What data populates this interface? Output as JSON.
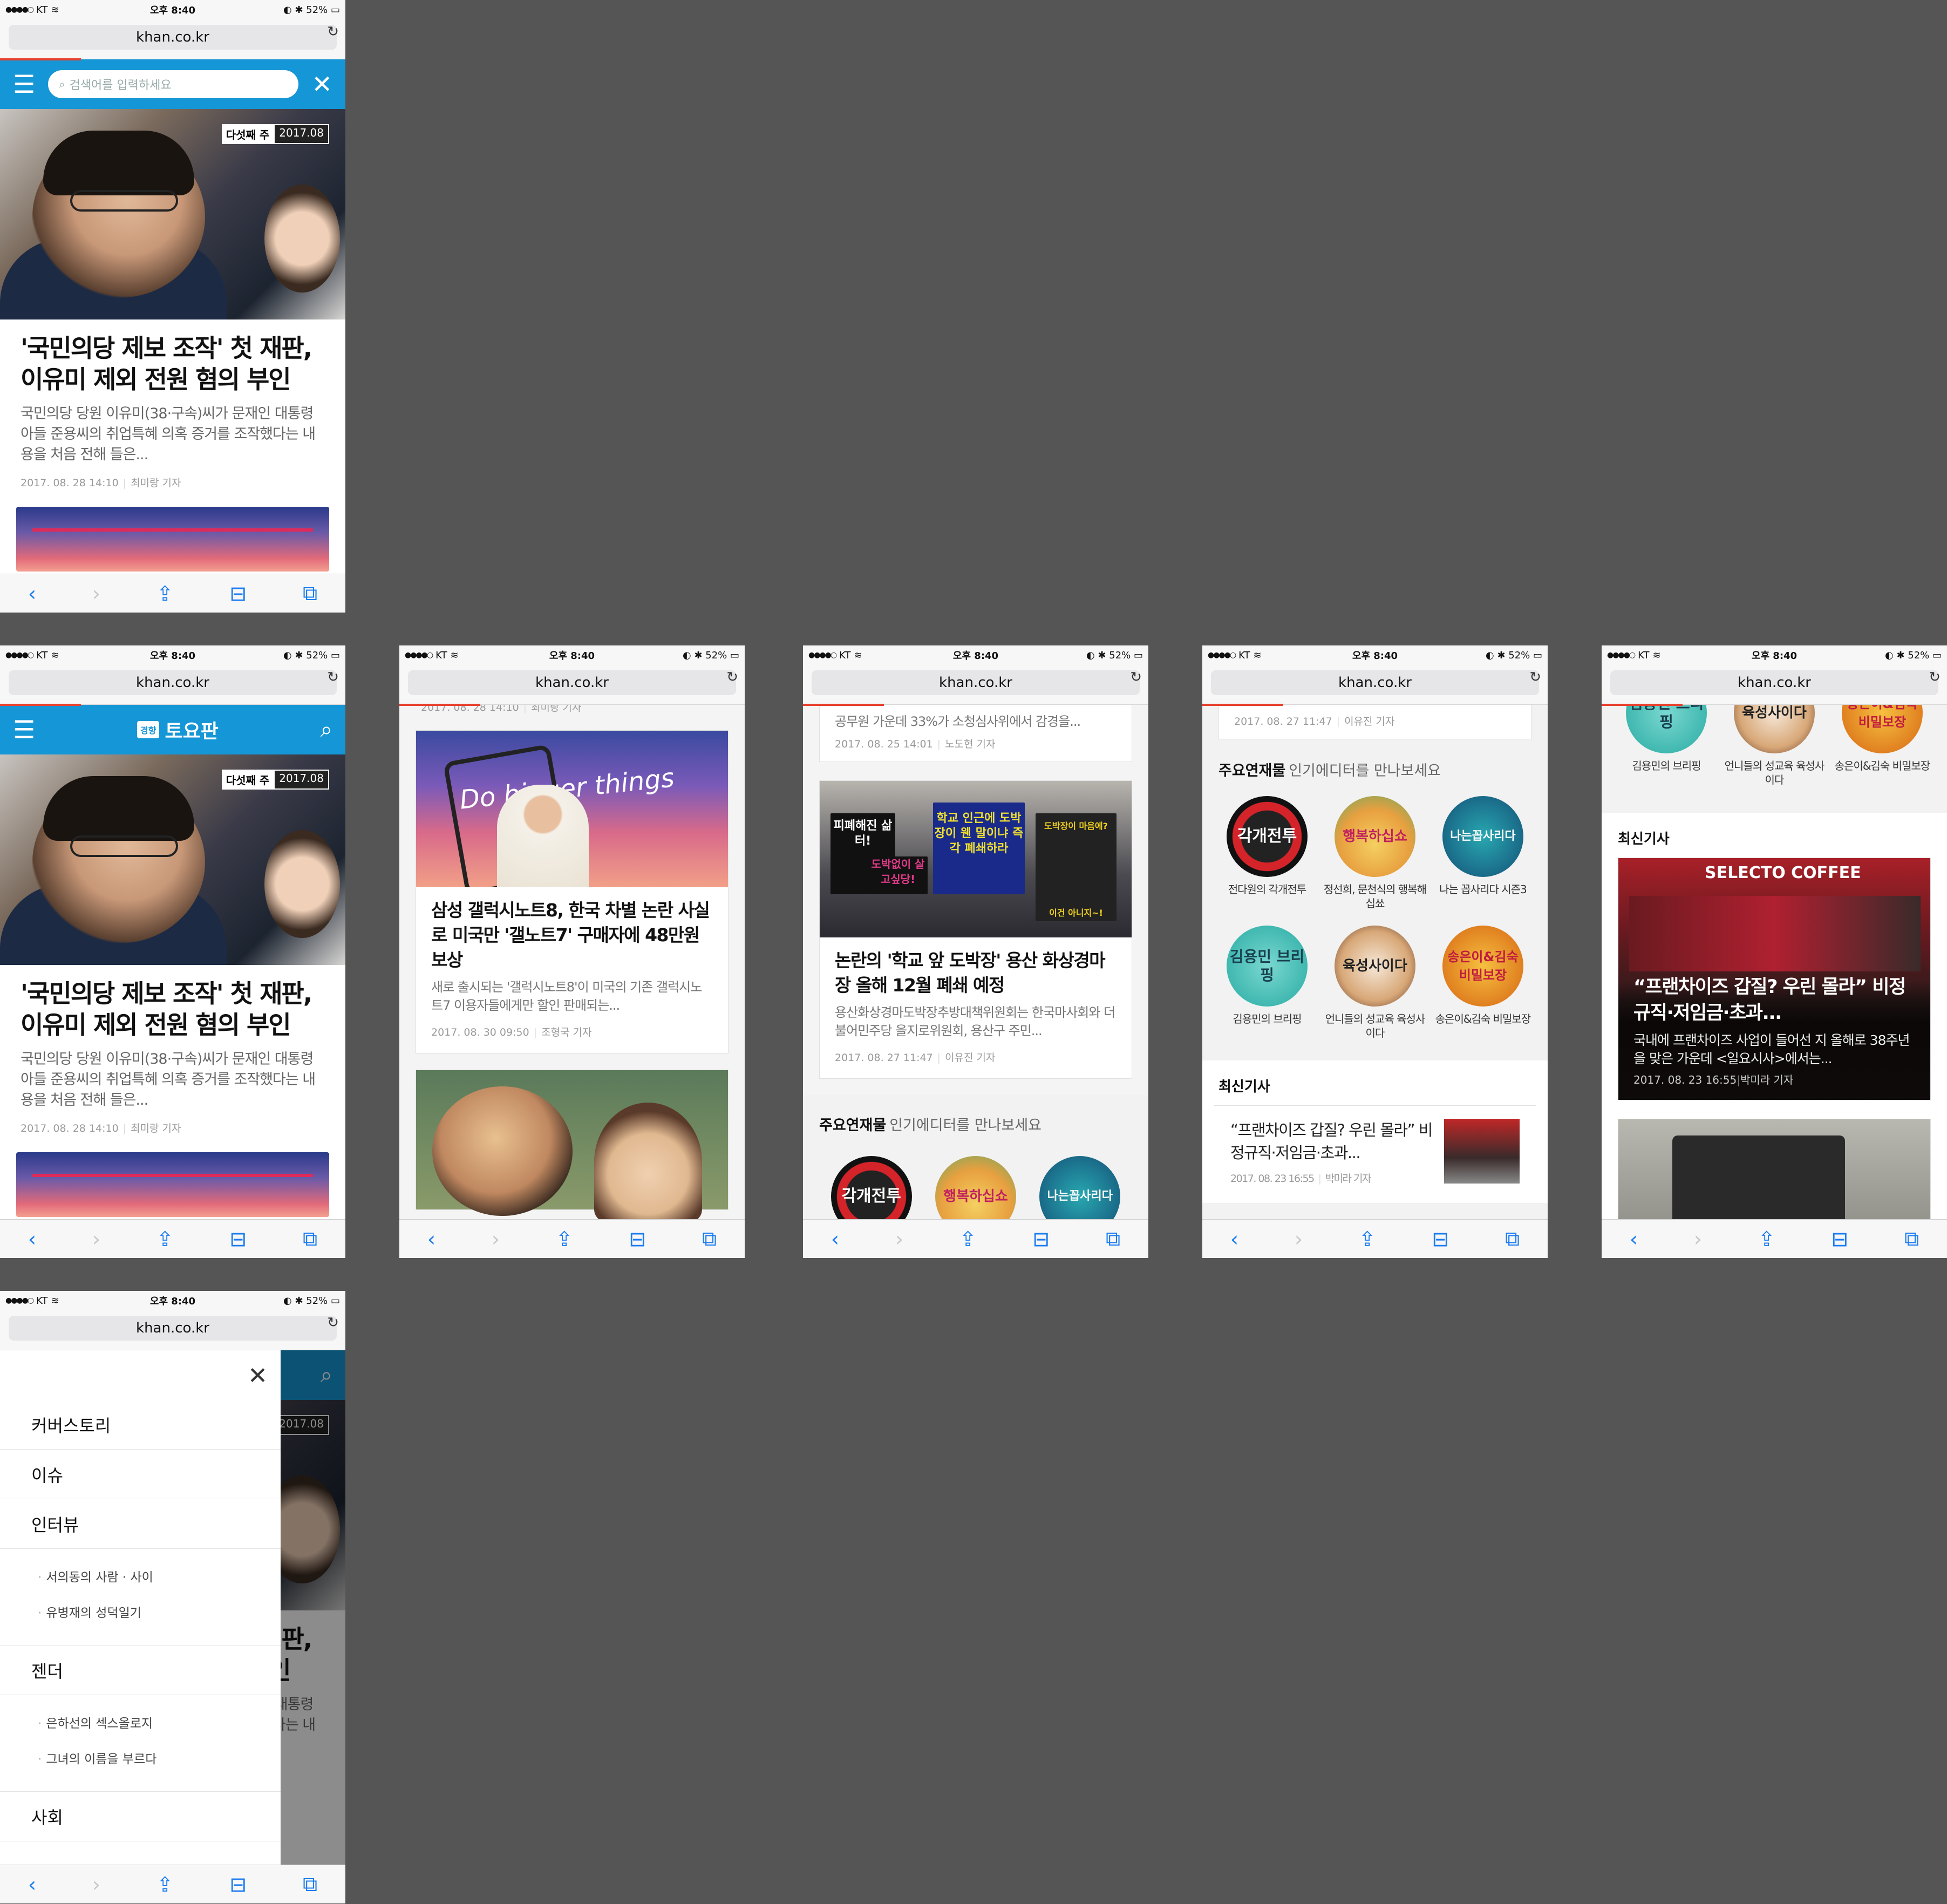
{
  "status": {
    "carrier": "KT",
    "time": "오후 8:40",
    "battery": "52%"
  },
  "url": "khan.co.kr",
  "header": {
    "logo_small": "경향",
    "logo_title": "토요판",
    "search_placeholder": "검색어를 입력하세요"
  },
  "hero": {
    "tag_main": "다섯째 주",
    "tag_date": "2017.08"
  },
  "lead": {
    "title": "'국민의당 제보 조작' 첫 재판, 이유미 제외 전원 혐의 부인",
    "summary": "국민의당 당원 이유미(38·구속)씨가 문재인 대통령 아들 준용씨의 취업특혜 의혹 증거를 조작했다는 내용을 처음 전해 들은...",
    "date": "2017. 08. 28 14:10",
    "author": "최미랑 기자"
  },
  "articles": [
    {
      "title": "삼성 갤럭시노트8, 한국 차별 논란 사실로 미국만 '갤노트7' 구매자에 48만원 보상",
      "summary": "새로 출시되는 '갤럭시노트8'이 미국의 기존 갤럭시노트7 이용자들에게만 할인 판매되는...",
      "date": "2017. 08. 30 09:50",
      "author": "조형국 기자",
      "img_text": "Do bigger things"
    },
    {
      "title": "논란의 '학교 앞 도박장' 용산 화상경마장 올해 12월 폐쇄 예정",
      "summary": "용산화상경마도박장추방대책위원회는 한국마사회와 더불어민주당 을지로위원회, 용산구 주민...",
      "date": "2017. 08. 27 11:47",
      "author": "이유진 기자",
      "prev_summary": "공무원 가운데 33%가 소청심사위에서 감경을...",
      "prev_date": "2017. 08. 25 14:01",
      "prev_author": "노도현 기자"
    }
  ],
  "protest_signs": [
    "피폐해진 삶터!",
    "도박없이 살고싶당!",
    "학교 인근에 도박장이 웬 말이냐 즉각 폐쇄하라",
    "도박장이 마음에?",
    "이건 아니지~!"
  ],
  "serials": {
    "heading": "주요연재물",
    "sub": "인기에디터를 만나보세요",
    "items": [
      {
        "art": "각개전투",
        "label": "전다원의 각개전투"
      },
      {
        "art": "행복하십쇼",
        "label": "정선희, 문천식의 행복해십쑈"
      },
      {
        "art": "나는꼽사리다",
        "label": "나는 꼽사리다 시즌3"
      },
      {
        "art": "김용민 브리핑",
        "label": "김용민의 브리핑"
      },
      {
        "art": "육성사이다",
        "label": "언니들의 성교육 육성사이다"
      },
      {
        "art": "송은이&김숙 비밀보장",
        "label": "송은이&김숙 비밀보장"
      }
    ]
  },
  "latest": {
    "heading": "최신기사",
    "item": {
      "title": "“프랜차이즈 갑질? 우린 몰라” 비정규직·저임금·초과...",
      "summary": "국내에 프랜차이즈 사업이 들어선 지 올해로 38주년을 맞은 가운데 <일요시사>에서는...",
      "date": "2017. 08. 23 16:55",
      "author": "박미라 기자",
      "img_text": "SELECTO COFFEE",
      "list_date": "2017. 08. 23 16:55",
      "list_author": "박미라 기자"
    },
    "prev_meta_date": "2017. 08. 27 11:47",
    "prev_meta_author": "이유진 기자"
  },
  "menu": {
    "items": [
      "커버스토리",
      "이슈",
      "인터뷰",
      "젠더",
      "사회"
    ],
    "interview_sub": [
      "서의동의 사람 · 사이",
      "유병재의 성덕일기"
    ],
    "gender_sub": [
      "은하선의 섹스올로지",
      "그녀의 이름을 부르다"
    ]
  },
  "colors": {
    "header_blue": "#1596d6",
    "progress_red": "#e8402d",
    "safari_blue": "#1b7cf0",
    "background": "#555555"
  }
}
